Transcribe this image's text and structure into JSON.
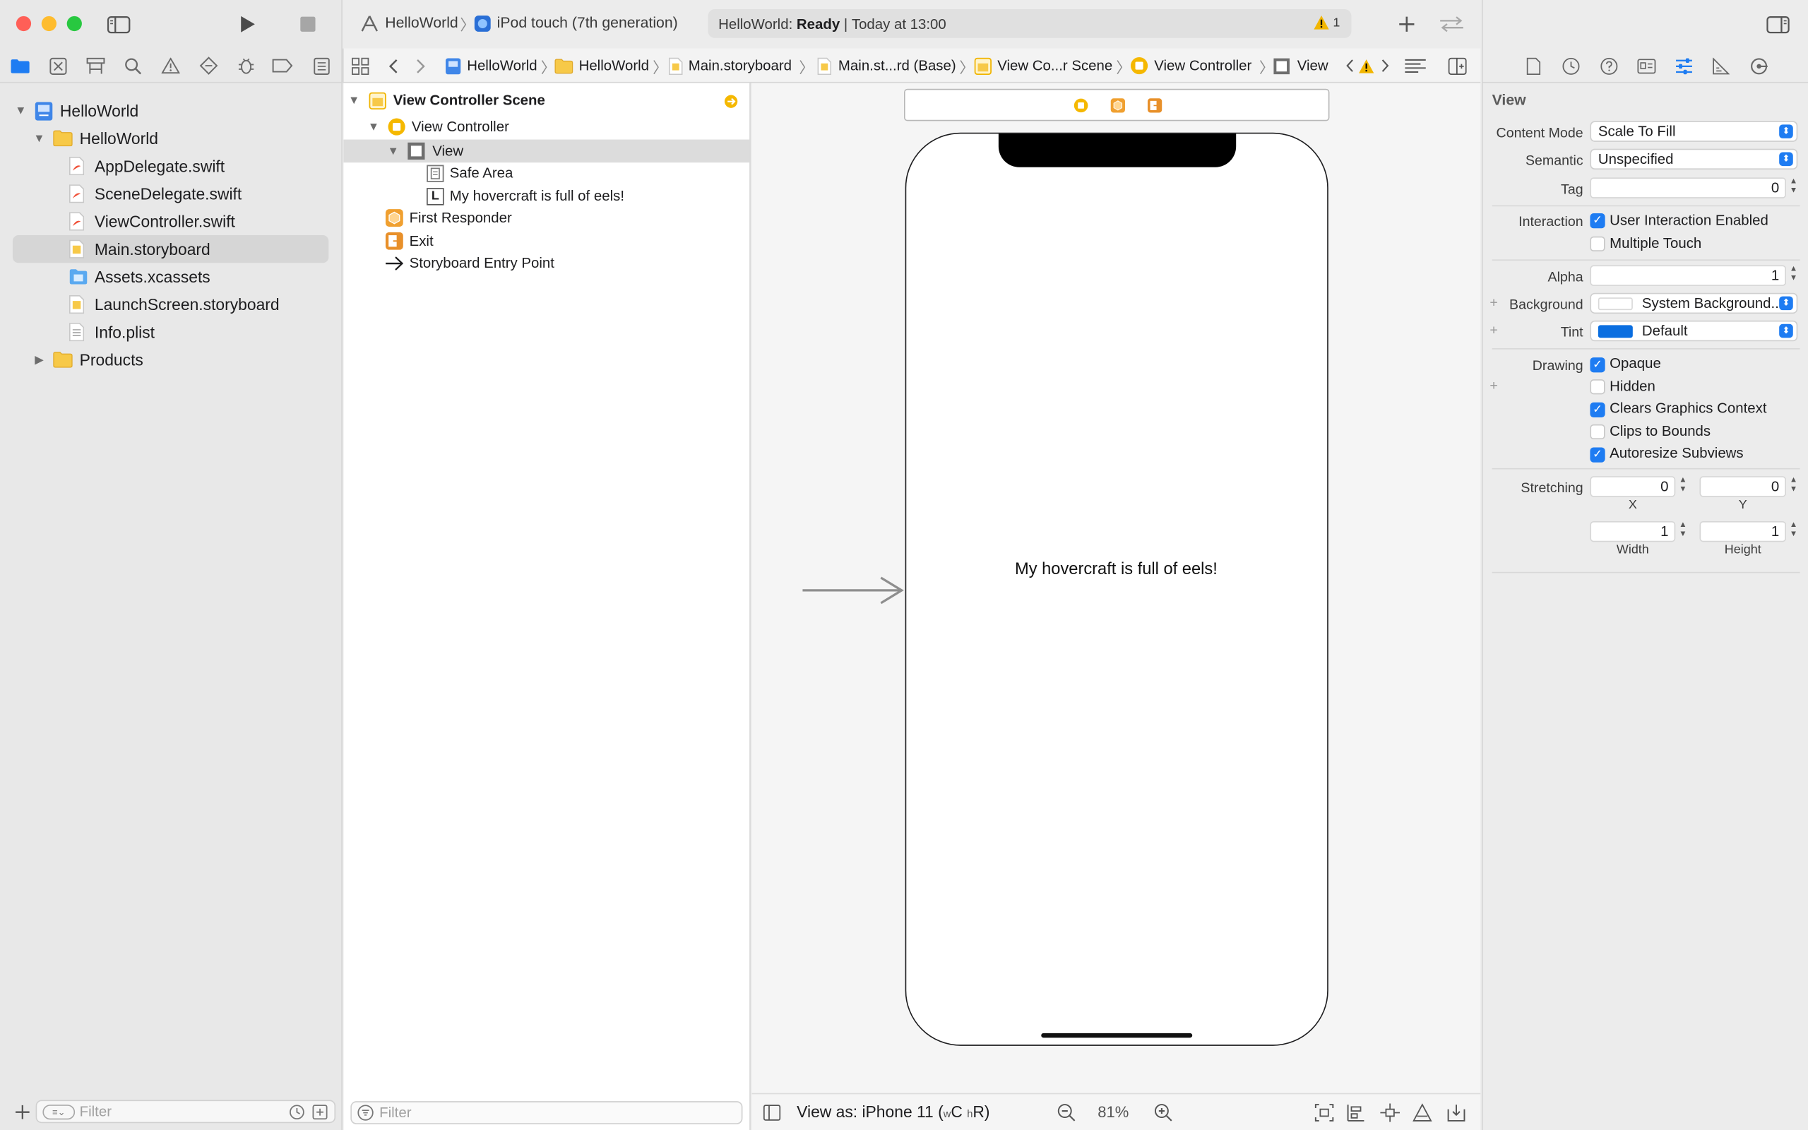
{
  "toolbar": {
    "scheme": "HelloWorld",
    "device": "iPod touch (7th generation)",
    "status_project": "HelloWorld:",
    "status_state": "Ready",
    "status_time": "Today at 13:00",
    "warning_count": "1"
  },
  "navigator": {
    "project": "HelloWorld",
    "group": "HelloWorld",
    "files": [
      "AppDelegate.swift",
      "SceneDelegate.swift",
      "ViewController.swift",
      "Main.storyboard",
      "Assets.xcassets",
      "LaunchScreen.storyboard",
      "Info.plist"
    ],
    "products": "Products",
    "filter_placeholder": "Filter"
  },
  "jumpbar": {
    "crumbs": [
      "HelloWorld",
      "HelloWorld",
      "Main.storyboard",
      "Main.st...rd (Base)",
      "View Co...r Scene",
      "View Controller",
      "View"
    ]
  },
  "outline": {
    "scene": "View Controller Scene",
    "view_controller": "View Controller",
    "view": "View",
    "safe_area": "Safe Area",
    "label_item": "My hovercraft is full of eels!",
    "label_glyph": "L",
    "first_responder": "First Responder",
    "exit": "Exit",
    "entry_point": "Storyboard Entry Point",
    "filter_placeholder": "Filter"
  },
  "canvas": {
    "label_text": "My hovercraft is full of eels!",
    "view_as_prefix": "View as: iPhone 11 (",
    "size_w": "w",
    "size_c": "C",
    "size_h": "h",
    "size_r": "R)",
    "zoom": "81%"
  },
  "inspector": {
    "section": "View",
    "content_mode_label": "Content Mode",
    "content_mode": "Scale To Fill",
    "semantic_label": "Semantic",
    "semantic": "Unspecified",
    "tag_label": "Tag",
    "tag": "0",
    "interaction_label": "Interaction",
    "user_interaction": "User Interaction Enabled",
    "multiple_touch": "Multiple Touch",
    "alpha_label": "Alpha",
    "alpha": "1",
    "background_label": "Background",
    "background": "System Background...",
    "tint_label": "Tint",
    "tint": "Default",
    "drawing_label": "Drawing",
    "opaque": "Opaque",
    "hidden": "Hidden",
    "clears_context": "Clears Graphics Context",
    "clips_bounds": "Clips to Bounds",
    "autoresize": "Autoresize Subviews",
    "stretching_label": "Stretching",
    "stretch_x": "0",
    "stretch_y": "0",
    "x_label": "X",
    "y_label": "Y",
    "stretch_w": "1",
    "stretch_h": "1",
    "width_label": "Width",
    "height_label": "Height"
  },
  "colors": {
    "accent": "#1e7cf2",
    "tint_swatch": "#0a6ee0",
    "scene_yellow": "#f5b800",
    "responder_orange": "#f0a030",
    "exit_orange": "#e8902a",
    "close": "#ff5f57",
    "minimize": "#febc2e",
    "zoom": "#28c840"
  }
}
